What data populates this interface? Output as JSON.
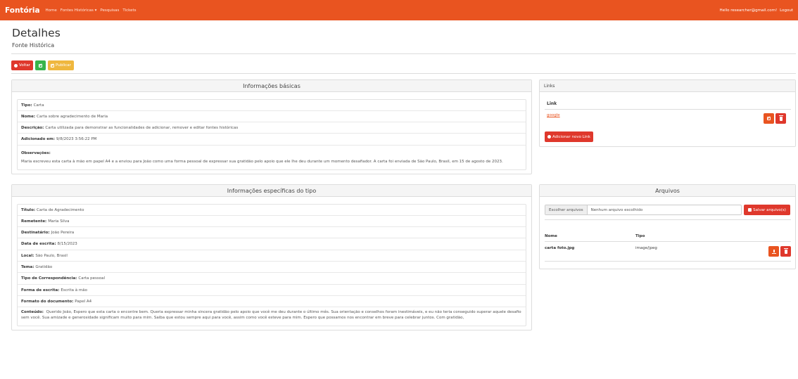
{
  "navbar": {
    "brand": "Fontória",
    "links": [
      "Home",
      "Fontes Históricas ▾",
      "Pesquisas",
      "Tickets"
    ],
    "greeting": "Hello researcher@gmail.com!",
    "logout": "Logout"
  },
  "header": {
    "title": "Detalhes",
    "subtitle": "Fonte Histórica"
  },
  "toolbar": {
    "back_label": "Voltar",
    "publish_label": "Publicar"
  },
  "basic_info": {
    "title": "Informações básicas",
    "fields": [
      {
        "label": "Tipo:",
        "value": "Carta"
      },
      {
        "label": "Nome:",
        "value": "Carta sobre agradecimento de Maria"
      },
      {
        "label": "Descrição:",
        "value": "Carta utilizada para demonstrar as funcionalidades de adicionar, remover e editar fontes históricas"
      },
      {
        "label": "Adicionado em:",
        "value": "9/8/2023 3:56:22 PM"
      }
    ],
    "observations_label": "Observações:",
    "observations_text": "Maria escreveu esta carta à mão em papel A4 e a enviou para João como uma forma pessoal de expressar sua gratidão pelo apoio que ele lhe deu durante um momento desafiador. A carta foi enviada de São Paulo, Brasil, em 15 de agosto de 2023."
  },
  "links": {
    "title": "Links",
    "column_label": "Link",
    "items": [
      {
        "text": "google"
      }
    ],
    "add_label": "Adicionar novo Link"
  },
  "type_info": {
    "title": "Informações específicas do tipo",
    "fields": [
      {
        "label": "Título:",
        "value": "Carta de Agradecimento"
      },
      {
        "label": "Remetente:",
        "value": "Maria Silva"
      },
      {
        "label": "Destinatário:",
        "value": "João Pereira"
      },
      {
        "label": "Data de escrita:",
        "value": "8/15/2023"
      },
      {
        "label": "Local:",
        "value": "São Paulo, Brasil"
      },
      {
        "label": "Tema:",
        "value": "Gratidão"
      },
      {
        "label": "Tipo de Correspondência:",
        "value": "Carta pessoal"
      },
      {
        "label": "Forma de escrita:",
        "value": "Escrita à mão"
      },
      {
        "label": "Formato do documento:",
        "value": "Papel A4"
      }
    ],
    "content_label": "Conteúdo:",
    "content_text": "Querido João, Espero que esta carta o encontre bem. Queria expressar minha sincera gratidão pelo apoio que você me deu durante o último mês. Sua orientação e conselhos foram inestimáveis, e eu não teria conseguido superar aquele desafio sem você. Sua amizade e generosidade significam muito para mim. Saiba que estou sempre aqui para você, assim como você esteve para mim. Espero que possamos nos encontrar em breve para celebrar juntos. Com gratidão,"
  },
  "files": {
    "title": "Arquivos",
    "choose_label": "Escolher arquivos",
    "none_chosen": "Nenhum arquivo escolhido",
    "save_label": "Salvar arquivo(s)",
    "columns": {
      "name": "Nome",
      "type": "Tipo"
    },
    "rows": [
      {
        "name": "carta foto.jpg",
        "type": "image/jpeg"
      }
    ]
  }
}
